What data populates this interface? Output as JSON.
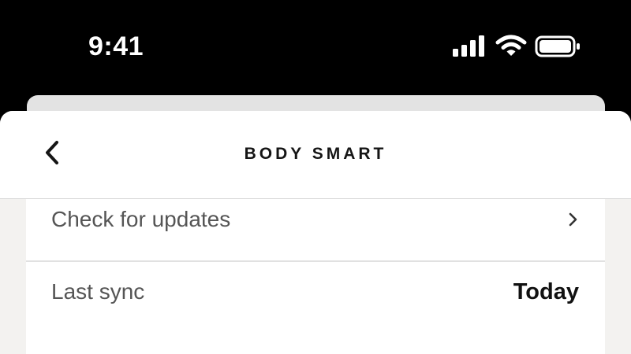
{
  "status_bar": {
    "time": "9:41",
    "icons": [
      "cellular-signal-icon",
      "wifi-icon",
      "battery-icon"
    ]
  },
  "header": {
    "title": "BODY SMART",
    "back_icon": "chevron-left-icon"
  },
  "settings": {
    "rows": [
      {
        "label": "Check for updates",
        "icon": "chevron-right-icon"
      },
      {
        "label": "Last sync",
        "value": "Today"
      }
    ]
  },
  "colors": {
    "status_bar_bg": "#000000",
    "sheet_bg": "#f3f2f0",
    "card_bg": "#ffffff",
    "title_text": "#151515",
    "label_text": "#555555"
  }
}
